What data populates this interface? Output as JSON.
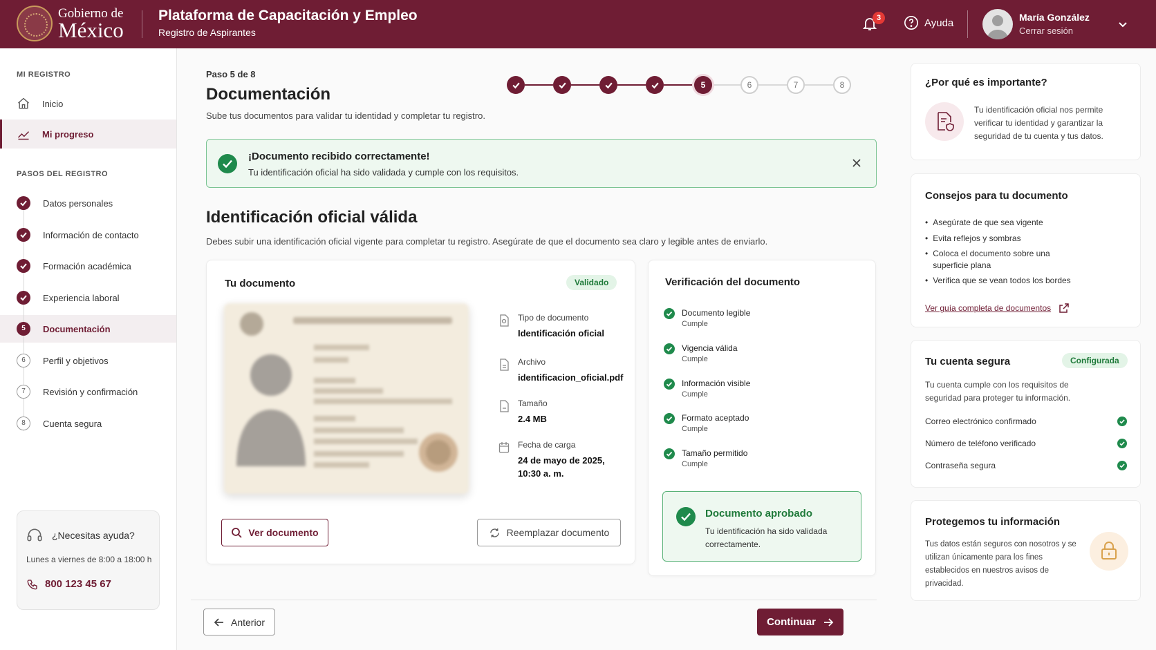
{
  "header": {
    "logo_line1": "Gobierno de",
    "logo_line2": "México",
    "app_title": "Plataforma de Capacitación y Empleo",
    "app_subtitle": "Registro de Aspirantes",
    "notifications_count": "3",
    "help_label": "Ayuda",
    "user_name": "María González",
    "logout_label": "Cerrar sesión",
    "brand_color": "#6f1d34"
  },
  "sidebar": {
    "section1_label": "MI REGISTRO",
    "nav": [
      {
        "label": "Inicio",
        "icon": "home-icon"
      },
      {
        "label": "Mi progreso",
        "icon": "trend-icon",
        "active": true
      }
    ],
    "section2_label": "PASOS DEL REGISTRO",
    "steps": [
      {
        "label": "Datos personales",
        "status": "done"
      },
      {
        "label": "Información de contacto",
        "status": "done"
      },
      {
        "label": "Formación académica",
        "status": "done"
      },
      {
        "label": "Experiencia laboral",
        "status": "done"
      },
      {
        "label": "Documentación",
        "status": "current",
        "num": "5"
      },
      {
        "label": "Perfil y objetivos",
        "status": "pending",
        "num": "6"
      },
      {
        "label": "Revisión y confirmación",
        "status": "pending",
        "num": "7"
      },
      {
        "label": "Cuenta segura",
        "status": "pending",
        "num": "8"
      }
    ],
    "help": {
      "title": "¿Necesitas ayuda?",
      "hours": "Lunes a viernes de 8:00 a 18:00 h",
      "phone": "800 123 45 67"
    }
  },
  "main": {
    "step_indicator": "Paso 5 de 8",
    "title": "Documentación",
    "subtitle": "Sube tus documentos para validar tu identidad y completar tu registro.",
    "stepper": [
      {
        "status": "done"
      },
      {
        "status": "done"
      },
      {
        "status": "done"
      },
      {
        "status": "done"
      },
      {
        "status": "current",
        "label": "5"
      },
      {
        "status": "pending",
        "label": "6"
      },
      {
        "status": "pending",
        "label": "7"
      },
      {
        "status": "pending",
        "label": "8"
      }
    ],
    "alert": {
      "title": "¡Documento recibido correctamente!",
      "text": "Tu identificación oficial ha sido validada y cumple con los requisitos."
    },
    "section_title": "Identificación oficial válida",
    "section_text": "Debes subir una identificación oficial vigente para completar tu registro. Asegúrate de que el documento sea claro y legible antes de enviarlo.",
    "document_card": {
      "title": "Tu documento",
      "status_badge": "Validado",
      "meta": [
        {
          "label": "Tipo de documento",
          "value": "Identificación oficial",
          "icon": "document-type-icon"
        },
        {
          "label": "Archivo",
          "value": "identificacion_oficial.pdf",
          "icon": "file-icon"
        },
        {
          "label": "Tamaño",
          "value": "2.4 MB",
          "icon": "file-size-icon"
        },
        {
          "label": "Fecha de carga",
          "value": "24 de mayo de 2025, 10:30 a. m.",
          "icon": "calendar-icon"
        }
      ],
      "view_button": "Ver documento",
      "replace_button": "Reemplazar documento"
    },
    "verification_card": {
      "title": "Verificación del documento",
      "checks": [
        {
          "label": "Documento legible",
          "status": "Cumple"
        },
        {
          "label": "Vigencia válida",
          "status": "Cumple"
        },
        {
          "label": "Información visible",
          "status": "Cumple"
        },
        {
          "label": "Formato aceptado",
          "status": "Cumple"
        },
        {
          "label": "Tamaño permitido",
          "status": "Cumple"
        }
      ],
      "approved_title": "Documento aprobado",
      "approved_text": "Tu identificación ha sido validada correctamente."
    },
    "nav": {
      "back_label": "Anterior",
      "continue_label": "Continuar"
    }
  },
  "right_panel": {
    "importance": {
      "title": "¿Por qué es importante?",
      "text": "Tu identificación oficial nos permite verificar tu identidad y garantizar la seguridad de tu cuenta y tus datos."
    },
    "tips": {
      "title": "Consejos para tu documento",
      "items": [
        "Asegúrate de que sea vigente",
        "Evita reflejos y sombras",
        "Coloca el documento sobre una superficie plana",
        "Verifica que se vean todos los bordes"
      ],
      "link": "Ver guía completa de documentos"
    },
    "secure": {
      "title": "Tu cuenta segura",
      "badge": "Configurada",
      "text": "Tu cuenta cumple con los requisitos de seguridad para proteger tu información.",
      "items": [
        "Correo electrónico confirmado",
        "Número de teléfono verificado",
        "Contraseña segura"
      ]
    },
    "protect": {
      "title": "Protegemos tu información",
      "text": "Tus datos están seguros con nosotros y se utilizan únicamente para los fines establecidos en nuestros avisos de privacidad."
    }
  }
}
